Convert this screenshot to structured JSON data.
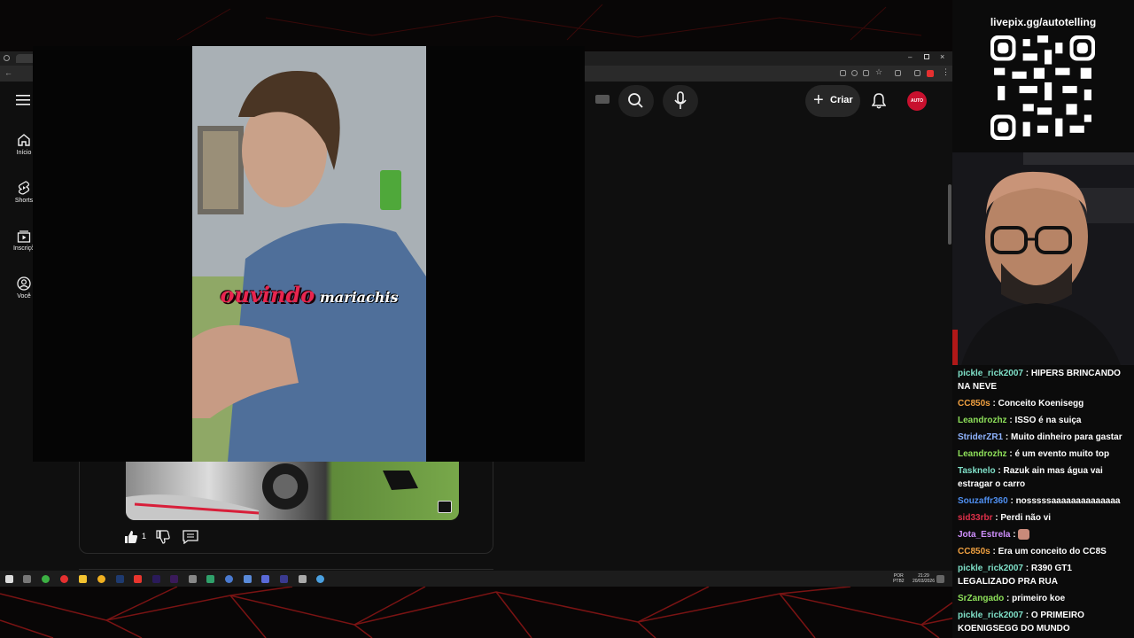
{
  "browser": {
    "sidebar": [
      {
        "label": "Início",
        "icon": "home-icon"
      },
      {
        "label": "Shorts",
        "icon": "shorts-icon"
      },
      {
        "label": "Inscriçõ",
        "icon": "subscriptions-icon"
      },
      {
        "label": "Você",
        "icon": "account-icon"
      }
    ],
    "header": {
      "create_label": "Criar",
      "avatar_text": "AUTO"
    }
  },
  "video": {
    "subtitle_word1": "ouvindo",
    "subtitle_word2": "mariachis"
  },
  "short_card": {
    "like_count": "1"
  },
  "taskbar": {
    "lang_line1": "POR",
    "lang_line2": "PTB2",
    "time": "21:29",
    "date": "20/03/2026"
  },
  "overlay": {
    "livepix": "livepix.gg/autotelling"
  },
  "chat": [
    {
      "user": "pickle_rick2007",
      "color": "#7fe0c8",
      "text": "HIPERS BRINCANDO NA NEVE"
    },
    {
      "user": "CC850s",
      "color": "#f0a040",
      "text": "Conceito Koenisegg"
    },
    {
      "user": "Leandrozhz",
      "color": "#8ee05a",
      "text": "ISSO é na suiça"
    },
    {
      "user": "StriderZR1",
      "color": "#8fb4ff",
      "text": "Muito dinheiro para gastar"
    },
    {
      "user": "Leandrozhz",
      "color": "#8ee05a",
      "text": "é um evento muito top"
    },
    {
      "user": "Tasknelo",
      "color": "#7fe0c8",
      "text": "Razuk ain mas água vai estragar o carro"
    },
    {
      "user": "Souzaffr360",
      "color": "#4f8ff0",
      "text": "nosssssaaaaaaaaaaaaaa"
    },
    {
      "user": "sid33rbr",
      "color": "#e0304a",
      "text": "Perdi não vi"
    },
    {
      "user": "Jota_Estrela",
      "color": "#d090ff",
      "text": ""
    },
    {
      "user": "CC850s",
      "color": "#f0a040",
      "text": "Era um conceito do CC8S"
    },
    {
      "user": "pickle_rick2007",
      "color": "#7fe0c8",
      "text": "R390 GT1 LEGALIZADO PRA RUA"
    },
    {
      "user": "SrZangado",
      "color": "#8ee05a",
      "text": "primeiro koe"
    },
    {
      "user": "pickle_rick2007",
      "color": "#7fe0c8",
      "text": "O PRIMEIRO KOENIGSEGG DO MUNDO"
    }
  ],
  "colors": {
    "accent_red": "#e8254f",
    "youtube_bg": "#0f0f0f"
  }
}
